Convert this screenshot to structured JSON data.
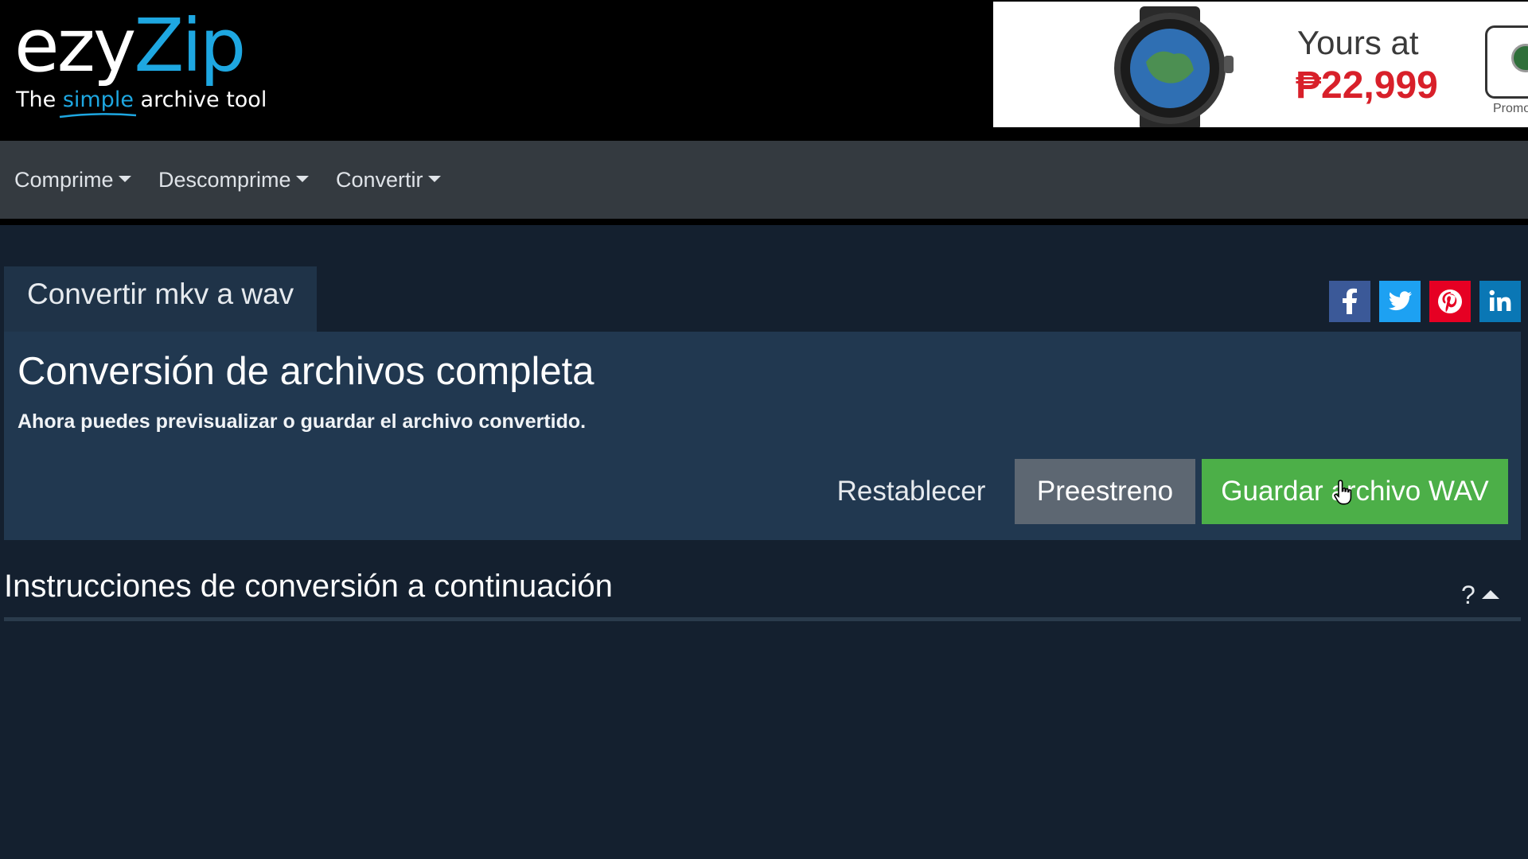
{
  "header": {
    "logo": {
      "brand_first": "ezy",
      "brand_second": "Zip",
      "tagline_before": "The ",
      "tagline_highlight": "simple",
      "tagline_after": " archive tool"
    },
    "ad": {
      "line1": "Yours at",
      "line2": "₱22,999",
      "promo": "Promo"
    }
  },
  "nav": {
    "items": [
      {
        "label": "Comprime"
      },
      {
        "label": "Descomprime"
      },
      {
        "label": "Convertir"
      }
    ]
  },
  "main": {
    "tab_label": "Convertir mkv a wav",
    "share_icons": [
      "facebook-icon",
      "twitter-icon",
      "pinterest-icon",
      "linkedin-icon"
    ],
    "panel": {
      "title": "Conversión de archivos completa",
      "subtitle": "Ahora puedes previsualizar o guardar el archivo convertido.",
      "buttons": {
        "reset": "Restablecer",
        "preview": "Preestreno",
        "save": "Guardar archivo WAV"
      }
    },
    "instructions": {
      "title": "Instrucciones de conversión a continuación",
      "help": "?"
    }
  },
  "colors": {
    "page_bg": "#14202f",
    "nav_bg": "#343a40",
    "panel_bg": "#213850",
    "brand_blue": "#1ea7e1",
    "save_green": "#4caf48",
    "preview_gray": "#5d6772",
    "facebook": "#3b5998",
    "twitter": "#1da1f2",
    "pinterest": "#e60023",
    "linkedin": "#0a77b5",
    "ad_price_red": "#d8202a"
  }
}
